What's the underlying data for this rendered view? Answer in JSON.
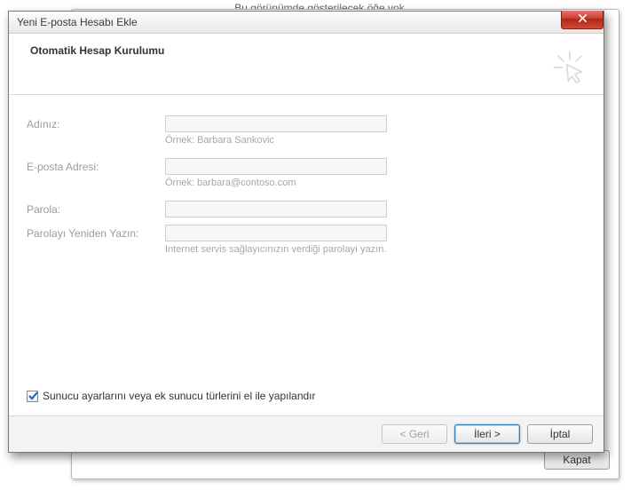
{
  "background_hint": "Bu görünümde gösterilecek öğe yok",
  "parent_panel": {
    "close_label": "Kapat"
  },
  "dialog": {
    "title": "Yeni E-posta Hesabı Ekle",
    "header": "Otomatik Hesap Kurulumu",
    "fields": {
      "name": {
        "label": "Adınız:",
        "value": "",
        "hint": "Örnek: Barbara Sankovic"
      },
      "email": {
        "label": "E-posta Adresi:",
        "value": "",
        "hint": "Örnek: barbara@contoso.com"
      },
      "password": {
        "label": "Parola:",
        "value": ""
      },
      "password_confirm": {
        "label": "Parolayı Yeniden Yazın:",
        "value": "",
        "hint": "Internet servis sağlayıcınızın verdiği parolayı yazın."
      }
    },
    "manual_config": {
      "label": "Sunucu ayarlarını veya ek sunucu türlerini el ile yapılandır",
      "checked": true
    },
    "buttons": {
      "back": "< Geri",
      "next": "İleri >",
      "cancel": "İptal"
    }
  }
}
